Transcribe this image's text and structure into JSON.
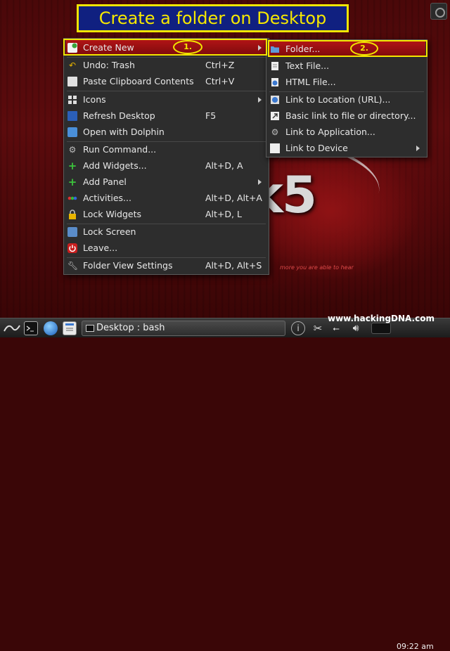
{
  "banner": {
    "title": "Create a folder on Desktop"
  },
  "annotations": {
    "step1": "1.",
    "step2": "2."
  },
  "main_menu": {
    "items": [
      {
        "id": "create-new",
        "label": "Create New",
        "underline": "N",
        "shortcut": "",
        "icon": "document-new-icon",
        "submenu": true,
        "highlighted": true
      },
      {
        "id": "undo-trash",
        "label": "Undo: Trash",
        "shortcut": "Ctrl+Z",
        "icon": "undo-icon"
      },
      {
        "id": "paste-clipboard",
        "label": "Paste Clipboard Contents",
        "shortcut": "Ctrl+V",
        "icon": "paste-icon"
      },
      {
        "id": "icons",
        "label": "Icons",
        "shortcut": "",
        "icon": "icons-grid-icon",
        "submenu": true
      },
      {
        "id": "refresh-desktop",
        "label": "Refresh Desktop",
        "shortcut": "F5",
        "icon": "refresh-desktop-icon"
      },
      {
        "id": "open-with-dolphin",
        "label": "Open with Dolphin",
        "shortcut": "",
        "icon": "dolphin-icon"
      },
      {
        "id": "run-command",
        "label": "Run Command...",
        "shortcut": "",
        "icon": "gear-icon"
      },
      {
        "id": "add-widgets",
        "label": "Add Widgets...",
        "shortcut": "Alt+D, A",
        "icon": "plus-icon"
      },
      {
        "id": "add-panel",
        "label": "Add Panel",
        "shortcut": "",
        "icon": "plus-icon",
        "submenu": true
      },
      {
        "id": "activities",
        "label": "Activities...",
        "shortcut": "Alt+D, Alt+A",
        "icon": "activities-dots-icon"
      },
      {
        "id": "lock-widgets",
        "label": "Lock Widgets",
        "shortcut": "Alt+D, L",
        "icon": "lock-icon"
      },
      {
        "id": "lock-screen",
        "label": "Lock Screen",
        "shortcut": "",
        "icon": "lock-screen-icon"
      },
      {
        "id": "leave",
        "label": "Leave...",
        "shortcut": "",
        "icon": "power-icon"
      },
      {
        "id": "folder-view-settings",
        "label": "Folder View Settings",
        "shortcut": "Alt+D, Alt+S",
        "icon": "wrench-icon"
      }
    ]
  },
  "sub_menu": {
    "items": [
      {
        "id": "folder",
        "label": "Folder...",
        "icon": "folder-icon",
        "highlighted": true
      },
      {
        "id": "text-file",
        "label": "Text File...",
        "icon": "text-file-icon"
      },
      {
        "id": "html-file",
        "label": "HTML File...",
        "icon": "html-file-icon"
      },
      {
        "id": "link-to-location",
        "label": "Link to Location (URL)...",
        "icon": "link-location-icon"
      },
      {
        "id": "basic-link",
        "label": "Basic link to file or directory...",
        "icon": "link-file-icon"
      },
      {
        "id": "link-to-application",
        "label": "Link to Application...",
        "icon": "gear-icon"
      },
      {
        "id": "link-to-device",
        "label": "Link to Device",
        "icon": "device-icon",
        "submenu": true
      }
    ]
  },
  "taskbar": {
    "task_label": "Desktop : bash",
    "clock": "09:22 am"
  },
  "desktop": {
    "wallpaper_text": "k5",
    "tagline": "more you are able to hear"
  },
  "watermark": "www.hackingDNA.com",
  "colors": {
    "accent": "#f2e600",
    "highlight": "#a01214",
    "banner_bg": "#102080"
  }
}
